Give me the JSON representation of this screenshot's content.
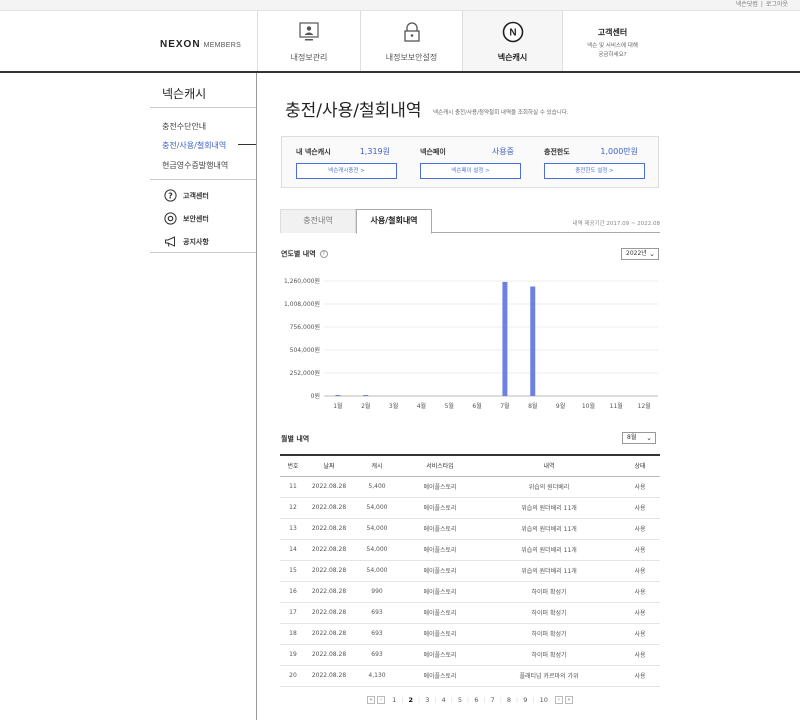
{
  "topbar": {
    "link1": "넥슨닷컴",
    "link2": "로그아웃"
  },
  "header": {
    "logo": "NEXON",
    "logo_sub": "MEMBERS",
    "tabs": [
      {
        "label": "내정보관리",
        "icon": "monitor-user-icon"
      },
      {
        "label": "내정보보안설정",
        "icon": "lock-icon"
      },
      {
        "label": "넥슨캐시",
        "icon": "nexon-coin-icon"
      }
    ],
    "cs": {
      "title": "고객센터",
      "desc1": "넥슨 및 서비스에 대해",
      "desc2": "궁금하세요?"
    }
  },
  "sidebar": {
    "title": "넥슨캐시",
    "items": [
      "충전수단안내",
      "충전/사용/철회내역",
      "현금영수증발행내역"
    ],
    "sub": [
      {
        "label": "고객센터",
        "icon": "question-circle-icon"
      },
      {
        "label": "보안센터",
        "icon": "shield-target-icon"
      },
      {
        "label": "공지사항",
        "icon": "megaphone-icon"
      }
    ]
  },
  "main": {
    "title": "충전/사용/철회내역",
    "desc": "넥슨캐시 충전/사용/청약철회 내역을 조회하실 수 있습니다.",
    "info": [
      {
        "key": "내 넥슨캐시",
        "value": "1,319원",
        "button": "넥슨캐시충전 >"
      },
      {
        "key": "넥슨페이",
        "value": "사용중",
        "button": "넥슨페이 설정 >"
      },
      {
        "key": "충전한도",
        "value": "1,000만원",
        "button": "충전한도 설정 >"
      }
    ],
    "tabs": [
      "충전내역",
      "사용/철회내역"
    ],
    "period": "내역 제공기간 2017.09 ~ 2022.08",
    "yearly_title": "연도별 내역",
    "year_select": "2022년",
    "monthly_title": "월별 내역",
    "month_select": "8월",
    "table_headers": [
      "번호",
      "날짜",
      "캐시",
      "서비스타입",
      "내역",
      "상태"
    ],
    "rows": [
      [
        "11",
        "2022.08.28",
        "5,400",
        "메이플스토리",
        "위습의 원더베리",
        "사용"
      ],
      [
        "12",
        "2022.08.28",
        "54,000",
        "메이플스토리",
        "위습의 원더베리 11개",
        "사용"
      ],
      [
        "13",
        "2022.08.28",
        "54,000",
        "메이플스토리",
        "위습의 원더베리 11개",
        "사용"
      ],
      [
        "14",
        "2022.08.28",
        "54,000",
        "메이플스토리",
        "위습의 원더베리 11개",
        "사용"
      ],
      [
        "15",
        "2022.08.28",
        "54,000",
        "메이플스토리",
        "위습의 원더베리 11개",
        "사용"
      ],
      [
        "16",
        "2022.08.28",
        "990",
        "메이플스토리",
        "하이퍼 확성기",
        "사용"
      ],
      [
        "17",
        "2022.08.28",
        "693",
        "메이플스토리",
        "하이퍼 확성기",
        "사용"
      ],
      [
        "18",
        "2022.08.28",
        "693",
        "메이플스토리",
        "하이퍼 확성기",
        "사용"
      ],
      [
        "19",
        "2022.08.28",
        "693",
        "메이플스토리",
        "하이퍼 확성기",
        "사용"
      ],
      [
        "20",
        "2022.08.28",
        "4,130",
        "메이플스토리",
        "플래티넘 카르마의 가위",
        "사용"
      ]
    ],
    "pager": {
      "pages": [
        "1",
        "2",
        "3",
        "4",
        "5",
        "6",
        "7",
        "8",
        "9",
        "10"
      ],
      "current": "2"
    }
  },
  "colors": {
    "accent": "#3e5fc9",
    "bar": "#6f80e3"
  },
  "chart_data": {
    "type": "bar",
    "categories": [
      "1월",
      "2월",
      "3월",
      "4월",
      "5월",
      "6월",
      "7월",
      "8월",
      "9월",
      "10월",
      "11월",
      "12월"
    ],
    "values": [
      4000,
      6000,
      0,
      0,
      0,
      0,
      1250000,
      1200000,
      0,
      0,
      0,
      0
    ],
    "y_ticks": [
      "0원",
      "252,000원",
      "504,000원",
      "756,000원",
      "1,008,000원",
      "1,260,000원"
    ],
    "ylim": [
      0,
      1260000
    ],
    "grid": true
  }
}
